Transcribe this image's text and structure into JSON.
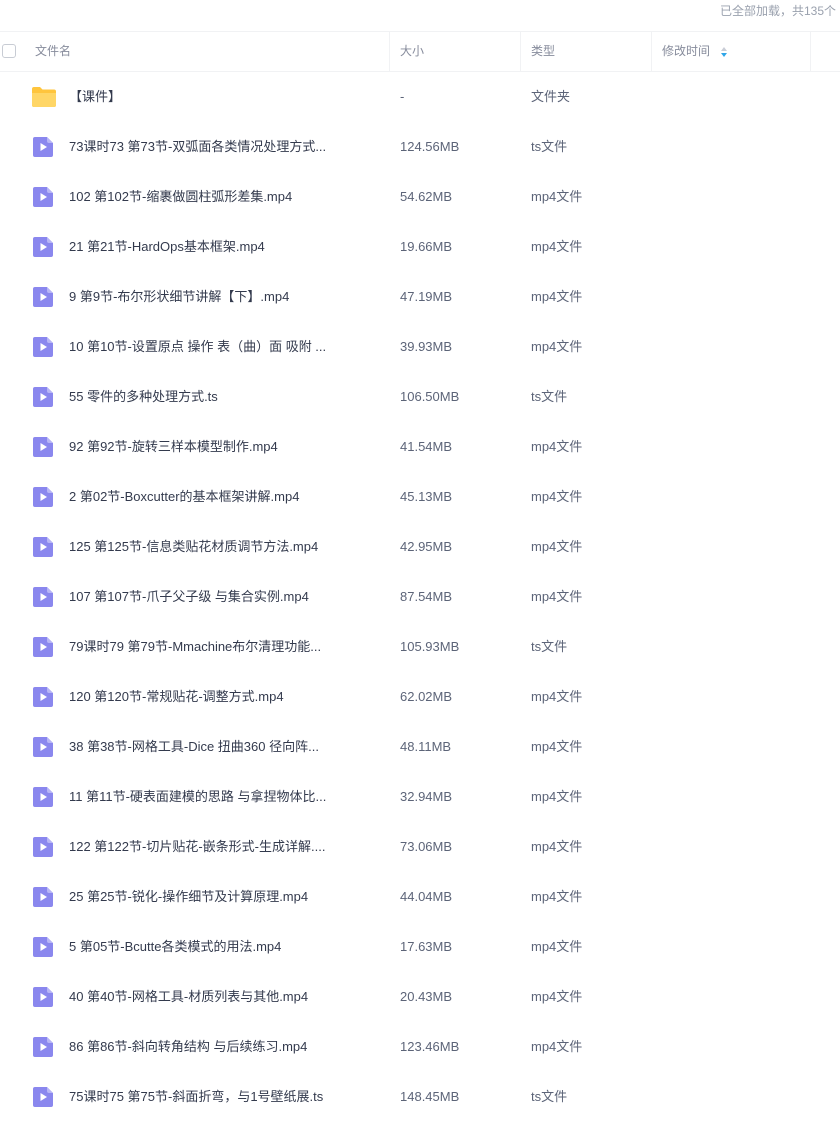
{
  "status_text": "已全部加载，共135个",
  "columns": {
    "name": "文件名",
    "size": "大小",
    "type": "类型",
    "modified": "修改时间"
  },
  "icons": {
    "folder": "folder-icon",
    "video": "video-file-icon",
    "sort": "sort-arrows-icon",
    "folder_color": "#ffc53d",
    "video_color": "#8a87ee"
  },
  "files": [
    {
      "kind": "folder",
      "name": "【课件】",
      "size": "-",
      "type": "文件夹"
    },
    {
      "kind": "video",
      "name": "73课时73 第73节-双弧面各类情况处理方式...",
      "size": "124.56MB",
      "type": "ts文件"
    },
    {
      "kind": "video",
      "name": "102 第102节-缩裹做圆柱弧形差集.mp4",
      "size": "54.62MB",
      "type": "mp4文件"
    },
    {
      "kind": "video",
      "name": "21 第21节-HardOps基本框架.mp4",
      "size": "19.66MB",
      "type": "mp4文件"
    },
    {
      "kind": "video",
      "name": "9 第9节-布尔形状细节讲解【下】.mp4",
      "size": "47.19MB",
      "type": "mp4文件"
    },
    {
      "kind": "video",
      "name": "10 第10节-设置原点 操作 表（曲）面 吸附 ...",
      "size": "39.93MB",
      "type": "mp4文件"
    },
    {
      "kind": "video",
      "name": "55 零件的多种处理方式.ts",
      "size": "106.50MB",
      "type": "ts文件"
    },
    {
      "kind": "video",
      "name": "92 第92节-旋转三样本模型制作.mp4",
      "size": "41.54MB",
      "type": "mp4文件"
    },
    {
      "kind": "video",
      "name": "2 第02节-Boxcutter的基本框架讲解.mp4",
      "size": "45.13MB",
      "type": "mp4文件"
    },
    {
      "kind": "video",
      "name": "125 第125节-信息类贴花材质调节方法.mp4",
      "size": "42.95MB",
      "type": "mp4文件"
    },
    {
      "kind": "video",
      "name": "107 第107节-爪子父子级 与集合实例.mp4",
      "size": "87.54MB",
      "type": "mp4文件"
    },
    {
      "kind": "video",
      "name": "79课时79 第79节-Mmachine布尔清理功能...",
      "size": "105.93MB",
      "type": "ts文件"
    },
    {
      "kind": "video",
      "name": "120 第120节-常规贴花-调整方式.mp4",
      "size": "62.02MB",
      "type": "mp4文件"
    },
    {
      "kind": "video",
      "name": "38 第38节-网格工具-Dice 扭曲360 径向阵...",
      "size": "48.11MB",
      "type": "mp4文件"
    },
    {
      "kind": "video",
      "name": "11 第11节-硬表面建模的思路 与拿捏物体比...",
      "size": "32.94MB",
      "type": "mp4文件"
    },
    {
      "kind": "video",
      "name": "122 第122节-切片贴花-嵌条形式-生成详解....",
      "size": "73.06MB",
      "type": "mp4文件"
    },
    {
      "kind": "video",
      "name": "25 第25节-锐化-操作细节及计算原理.mp4",
      "size": "44.04MB",
      "type": "mp4文件"
    },
    {
      "kind": "video",
      "name": "5 第05节-Bcutte各类模式的用法.mp4",
      "size": "17.63MB",
      "type": "mp4文件"
    },
    {
      "kind": "video",
      "name": "40 第40节-网格工具-材质列表与其他.mp4",
      "size": "20.43MB",
      "type": "mp4文件"
    },
    {
      "kind": "video",
      "name": "86 第86节-斜向转角结构 与后续练习.mp4",
      "size": "123.46MB",
      "type": "mp4文件"
    },
    {
      "kind": "video",
      "name": "75课时75 第75节-斜面折弯，与1号壁纸展.ts",
      "size": "148.45MB",
      "type": "ts文件"
    }
  ]
}
